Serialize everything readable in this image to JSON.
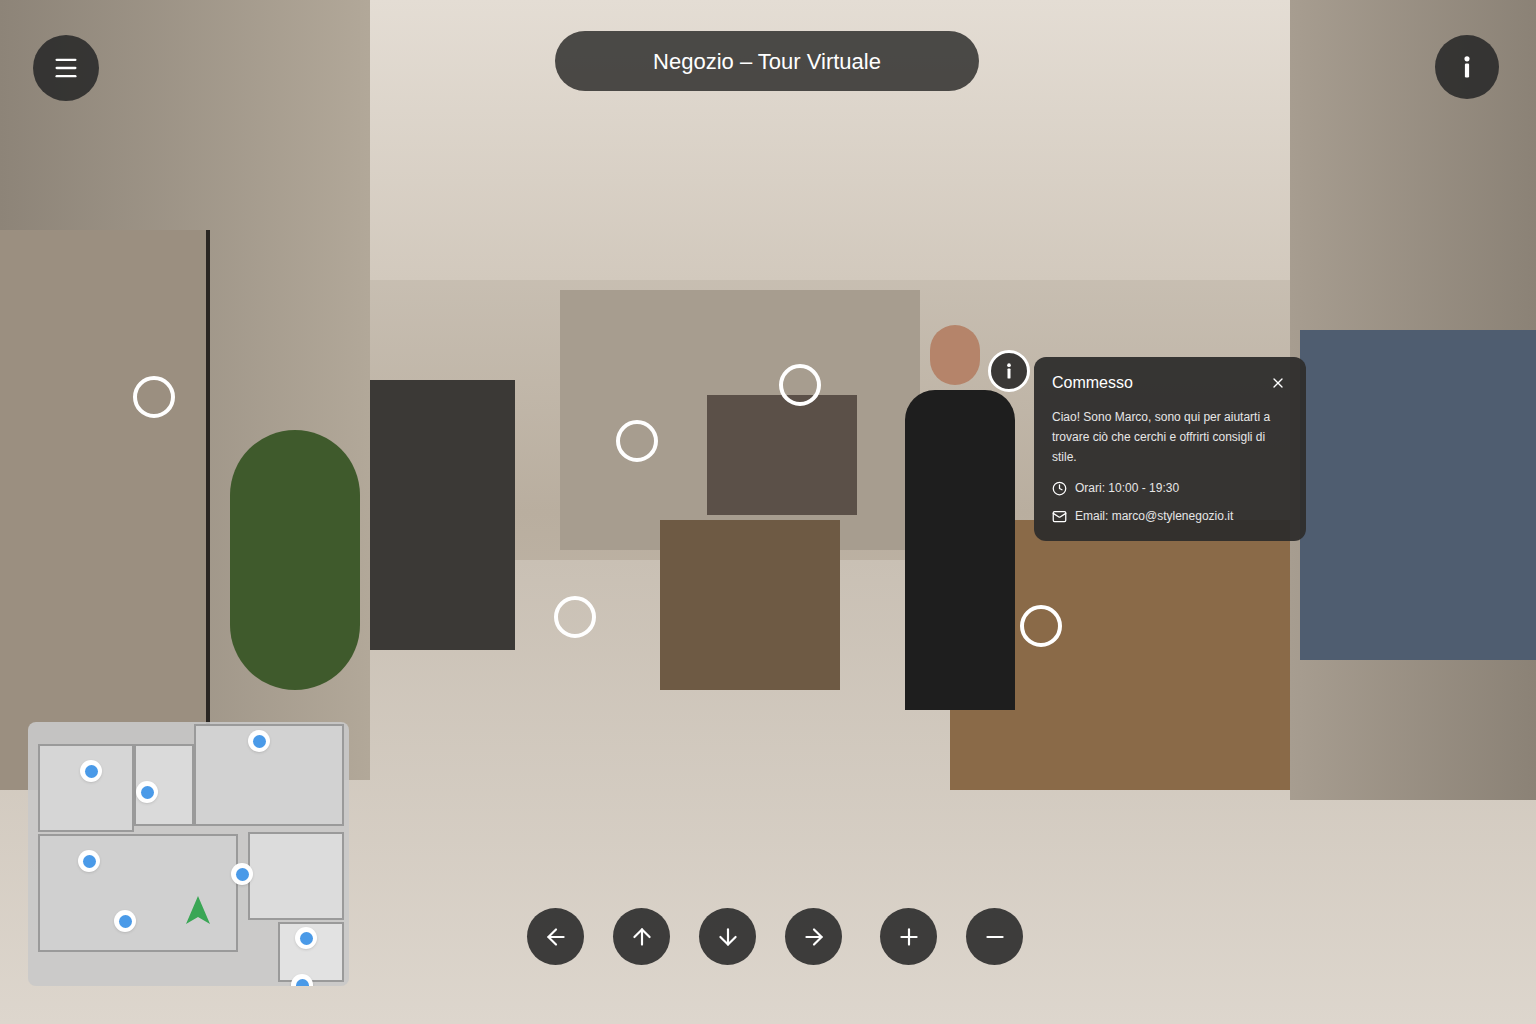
{
  "window": {
    "title": "Negozio – Tour Virtuale"
  },
  "popup": {
    "title": "Commesso",
    "message": "Ciao! Sono Marco, sono qui per aiutarti a trovare ciò che cerchi e offrirti consigli di stile.",
    "hours": "Orari: 10:00 - 19:30",
    "email": "Email: marco@stylenegozio.it",
    "open": true
  },
  "hotspots": [
    {
      "kind": "ring"
    },
    {
      "kind": "ring"
    },
    {
      "kind": "ring"
    },
    {
      "kind": "ring"
    },
    {
      "kind": "ring"
    },
    {
      "kind": "info"
    }
  ],
  "minimap": {
    "pins": 8
  }
}
